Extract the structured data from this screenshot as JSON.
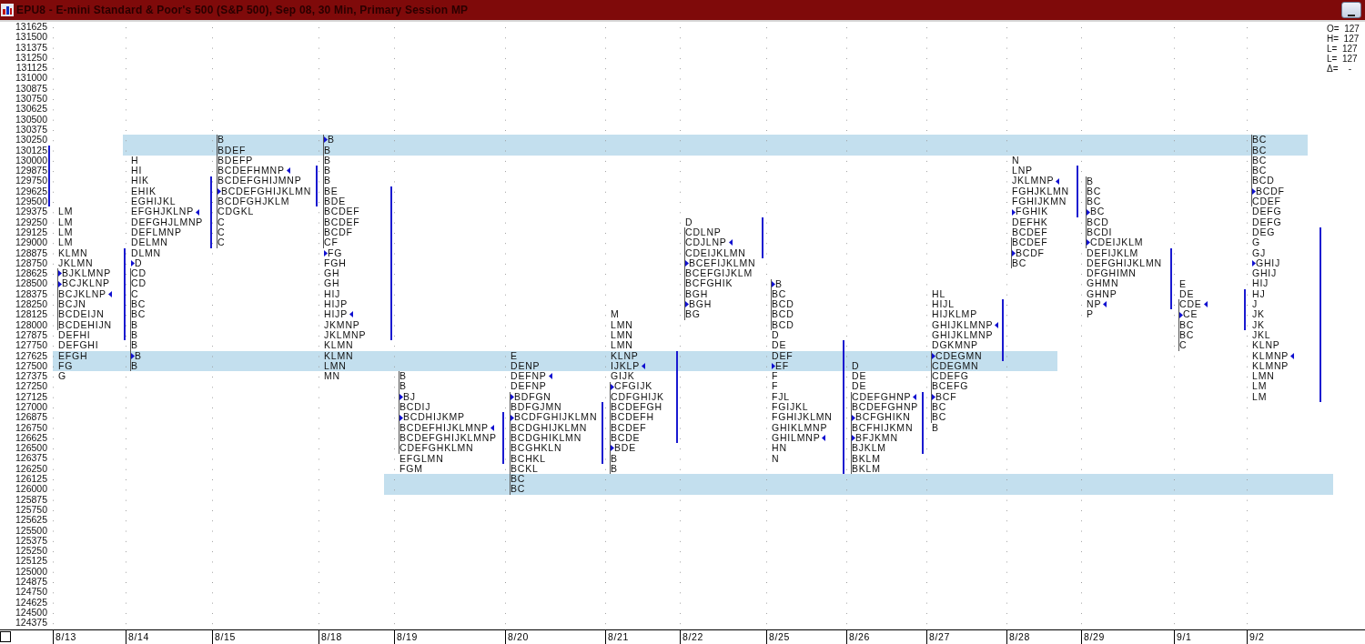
{
  "window": {
    "title": "EPU8 - E-mini Standard & Poor's 500 (S&P 500), Sep 08, 30 Min, Primary Session MP"
  },
  "price_axis": [
    "131625",
    "131500",
    "131375",
    "131250",
    "131125",
    "131000",
    "130875",
    "130750",
    "130625",
    "130500",
    "130375",
    "130250",
    "130125",
    "130000",
    "129875",
    "129750",
    "129625",
    "129500",
    "129375",
    "129250",
    "129125",
    "129000",
    "128875",
    "128750",
    "128625",
    "128500",
    "128375",
    "128250",
    "128125",
    "128000",
    "127875",
    "127750",
    "127625",
    "127500",
    "127375",
    "127250",
    "127125",
    "127000",
    "126875",
    "126750",
    "126625",
    "126500",
    "126375",
    "126250",
    "126125",
    "126000",
    "125875",
    "125750",
    "125625",
    "125500",
    "125375",
    "125250",
    "125125",
    "125000",
    "124875",
    "124750",
    "124625",
    "124500",
    "124375"
  ],
  "quote_box": [
    "O=  127",
    "H=  127",
    "L=  127",
    "L=  127",
    "Δ=    -"
  ],
  "profiles": [
    {
      "date": "8/13",
      "rows": [
        {
          "letters": "LM"
        },
        {
          "letters": "LM"
        },
        {
          "letters": "LM"
        },
        {
          "letters": "LM"
        },
        {
          "letters": "KLMN"
        },
        {
          "letters": "JKLMN"
        },
        {
          "letters": "BJKLMNP",
          "open": true
        },
        {
          "letters": "BCJKLNP",
          "open": true
        },
        {
          "letters": "BCJKLNP",
          "close": true
        },
        {
          "letters": "BCJN"
        },
        {
          "letters": "BCDEIJN"
        },
        {
          "letters": "BCDEHIJN"
        },
        {
          "letters": "DEFHI"
        },
        {
          "letters": "DEFGHI"
        },
        {
          "letters": "EFGH"
        },
        {
          "letters": "FG"
        },
        {
          "letters": "G"
        }
      ]
    },
    {
      "date": "8/14",
      "rows": [
        {
          "letters": "H"
        },
        {
          "letters": "HI"
        },
        {
          "letters": "HIK"
        },
        {
          "letters": "EHIK"
        },
        {
          "letters": "EGHIJKL"
        },
        {
          "letters": "EFGHJKLNP",
          "close": true
        },
        {
          "letters": "DEFGHJLMNP"
        },
        {
          "letters": "DEFLMNP"
        },
        {
          "letters": "DELMN"
        },
        {
          "letters": "DLMN"
        },
        {
          "letters": "D",
          "open": true
        },
        {
          "letters": "CD"
        },
        {
          "letters": "CD"
        },
        {
          "letters": "C"
        },
        {
          "letters": "BC"
        },
        {
          "letters": "BC"
        },
        {
          "letters": "B"
        },
        {
          "letters": "B"
        },
        {
          "letters": "B"
        },
        {
          "letters": "B",
          "open": true
        },
        {
          "letters": "B"
        }
      ]
    },
    {
      "date": "8/15",
      "rows": [
        {
          "letters": "B"
        },
        {
          "letters": "BDEF"
        },
        {
          "letters": "BDEFP"
        },
        {
          "letters": "BCDEFHMNP",
          "close": true
        },
        {
          "letters": "BCDEFGHIJMNP"
        },
        {
          "letters": "BCDEFGHIJKLMN",
          "open": true
        },
        {
          "letters": "BCDFGHJKLM"
        },
        {
          "letters": "CDGKL"
        },
        {
          "letters": "C"
        },
        {
          "letters": "C"
        },
        {
          "letters": "C"
        }
      ]
    },
    {
      "date": "8/18",
      "rows": [
        {
          "letters": "B",
          "open": true
        },
        {
          "letters": "B"
        },
        {
          "letters": "B"
        },
        {
          "letters": "B"
        },
        {
          "letters": "B"
        },
        {
          "letters": "BE"
        },
        {
          "letters": "BDE"
        },
        {
          "letters": "BCDEF"
        },
        {
          "letters": "BCDEF"
        },
        {
          "letters": "BCDF"
        },
        {
          "letters": "CF"
        },
        {
          "letters": "FG",
          "open": true
        },
        {
          "letters": "FGH"
        },
        {
          "letters": "GH"
        },
        {
          "letters": "GH"
        },
        {
          "letters": "HIJ"
        },
        {
          "letters": "HIJP"
        },
        {
          "letters": "HIJP",
          "close": true
        },
        {
          "letters": "JKMNP"
        },
        {
          "letters": "JKLMNP"
        },
        {
          "letters": "KLMN"
        },
        {
          "letters": "KLMN"
        },
        {
          "letters": "LMN"
        },
        {
          "letters": "MN"
        }
      ]
    },
    {
      "date": "8/19",
      "rows": [
        {
          "letters": "B"
        },
        {
          "letters": "B"
        },
        {
          "letters": "BJ",
          "open": true
        },
        {
          "letters": "BCDIJ"
        },
        {
          "letters": "BCDHIJKMP",
          "open": true
        },
        {
          "letters": "BCDEFHIJKLMNP",
          "close": true
        },
        {
          "letters": "BCDEFGHIJKLMNP"
        },
        {
          "letters": "CDEFGHKLMN"
        },
        {
          "letters": "EFGLMN"
        },
        {
          "letters": "FGM"
        }
      ]
    },
    {
      "date": "8/20",
      "rows": [
        {
          "letters": "E"
        },
        {
          "letters": "DENP"
        },
        {
          "letters": "DEFNP",
          "close": true
        },
        {
          "letters": "DEFNP"
        },
        {
          "letters": "BDFGN",
          "open": true
        },
        {
          "letters": "BDFGJMN"
        },
        {
          "letters": "BCDFGHIJKLMN",
          "open": true
        },
        {
          "letters": "BCDGHIJKLMN"
        },
        {
          "letters": "BCDGHIKLMN"
        },
        {
          "letters": "BCGHKLN"
        },
        {
          "letters": "BCHKL"
        },
        {
          "letters": "BCKL"
        },
        {
          "letters": "BC"
        },
        {
          "letters": "BC"
        }
      ]
    },
    {
      "date": "8/21",
      "rows": [
        {
          "letters": "M"
        },
        {
          "letters": "LMN"
        },
        {
          "letters": "LMN"
        },
        {
          "letters": "LMN"
        },
        {
          "letters": "KLNP"
        },
        {
          "letters": "IJKLP",
          "close": true
        },
        {
          "letters": "GIJK"
        },
        {
          "letters": "CFGIJK",
          "open": true
        },
        {
          "letters": "CDFGHIJK"
        },
        {
          "letters": "BCDEFGH"
        },
        {
          "letters": "BCDEFH"
        },
        {
          "letters": "BCDEF"
        },
        {
          "letters": "BCDE"
        },
        {
          "letters": "BDE",
          "open": true
        },
        {
          "letters": "B"
        },
        {
          "letters": "B"
        }
      ]
    },
    {
      "date": "8/22",
      "rows": [
        {
          "letters": "D"
        },
        {
          "letters": "CDLNP"
        },
        {
          "letters": "CDJLNP",
          "close": true
        },
        {
          "letters": "CDEIJKLMN"
        },
        {
          "letters": "BCEFIJKLMN",
          "open": true
        },
        {
          "letters": "BCEFGIJKLM"
        },
        {
          "letters": "BCFGHIK"
        },
        {
          "letters": "BGH"
        },
        {
          "letters": "BGH",
          "open": true
        },
        {
          "letters": "BG"
        }
      ]
    },
    {
      "date": "8/25",
      "rows": [
        {
          "letters": "B",
          "open": true
        },
        {
          "letters": "BC"
        },
        {
          "letters": "BCD"
        },
        {
          "letters": "BCD"
        },
        {
          "letters": "BCD"
        },
        {
          "letters": "D"
        },
        {
          "letters": "DE"
        },
        {
          "letters": "DEF"
        },
        {
          "letters": "EF",
          "open": true
        },
        {
          "letters": "F"
        },
        {
          "letters": "F"
        },
        {
          "letters": "FJL"
        },
        {
          "letters": "FGIJKL"
        },
        {
          "letters": "FGHIJKLMN"
        },
        {
          "letters": "GHIKLMNP"
        },
        {
          "letters": "GHILMNP",
          "close": true
        },
        {
          "letters": "HN"
        },
        {
          "letters": "N"
        }
      ]
    },
    {
      "date": "8/26",
      "rows": [
        {
          "letters": "D"
        },
        {
          "letters": "DE"
        },
        {
          "letters": "DE"
        },
        {
          "letters": "CDEFGHNP",
          "close": true
        },
        {
          "letters": "BCDEFGHNP"
        },
        {
          "letters": "BCFGHIKN",
          "open": true
        },
        {
          "letters": "BCFHIJKMN"
        },
        {
          "letters": "BFJKMN",
          "open": true
        },
        {
          "letters": "BJKLM"
        },
        {
          "letters": "BKLM"
        },
        {
          "letters": "BKLM"
        }
      ]
    },
    {
      "date": "8/27",
      "rows": [
        {
          "letters": "HL"
        },
        {
          "letters": "HIJL"
        },
        {
          "letters": "HIJKLMP"
        },
        {
          "letters": "GHIJKLMNP",
          "close": true
        },
        {
          "letters": "GHIJKLMNP"
        },
        {
          "letters": "DGKMNP"
        },
        {
          "letters": "CDEGMN",
          "open": true
        },
        {
          "letters": "CDEGMN"
        },
        {
          "letters": "CDEFG"
        },
        {
          "letters": "BCEFG"
        },
        {
          "letters": "BCF",
          "open": true
        },
        {
          "letters": "BC"
        },
        {
          "letters": "BC"
        },
        {
          "letters": "B"
        }
      ]
    },
    {
      "date": "8/28",
      "rows": [
        {
          "letters": "N"
        },
        {
          "letters": "LNP"
        },
        {
          "letters": "JKLMNP",
          "close": true
        },
        {
          "letters": "FGHJKLMN"
        },
        {
          "letters": "FGHIJKMN"
        },
        {
          "letters": "FGHIK",
          "open": true
        },
        {
          "letters": "DEFHK"
        },
        {
          "letters": "BCDEF"
        },
        {
          "letters": "BCDEF"
        },
        {
          "letters": "BCDF",
          "open": true
        },
        {
          "letters": "BC"
        }
      ]
    },
    {
      "date": "8/29",
      "rows": [
        {
          "letters": "B"
        },
        {
          "letters": "BC"
        },
        {
          "letters": "BC"
        },
        {
          "letters": "BC",
          "open": true
        },
        {
          "letters": "BCD"
        },
        {
          "letters": "BCDI"
        },
        {
          "letters": "CDEIJKLM",
          "open": true
        },
        {
          "letters": "DEFIJKLM"
        },
        {
          "letters": "DEFGHIJKLMN"
        },
        {
          "letters": "DFGHIMN"
        },
        {
          "letters": "GHMN"
        },
        {
          "letters": "GHNP"
        },
        {
          "letters": "NP",
          "close": true
        },
        {
          "letters": "P"
        }
      ]
    },
    {
      "date": "9/1",
      "rows": [
        {
          "letters": "E"
        },
        {
          "letters": "DE"
        },
        {
          "letters": "CDE",
          "close": true
        },
        {
          "letters": "CE",
          "open": true
        },
        {
          "letters": "BC"
        },
        {
          "letters": "BC"
        },
        {
          "letters": "C"
        }
      ]
    },
    {
      "date": "9/2",
      "rows": [
        {
          "letters": "BC"
        },
        {
          "letters": "BC"
        },
        {
          "letters": "BC"
        },
        {
          "letters": "BC"
        },
        {
          "letters": "BCD"
        },
        {
          "letters": "BCDF",
          "open": true
        },
        {
          "letters": "CDEF"
        },
        {
          "letters": "DEFG"
        },
        {
          "letters": "DEFG"
        },
        {
          "letters": "DEG"
        },
        {
          "letters": "G"
        },
        {
          "letters": "GJ"
        },
        {
          "letters": "GHIJ",
          "open": true
        },
        {
          "letters": "GHIJ"
        },
        {
          "letters": "HIJ"
        },
        {
          "letters": "HJ"
        },
        {
          "letters": "J"
        },
        {
          "letters": "JK"
        },
        {
          "letters": "JK"
        },
        {
          "letters": "JKL"
        },
        {
          "letters": "KLNP"
        },
        {
          "letters": "KLMNP",
          "close": true
        },
        {
          "letters": "KLMNP"
        },
        {
          "letters": "LMN"
        },
        {
          "letters": "LM"
        },
        {
          "letters": "LM"
        }
      ]
    }
  ]
}
